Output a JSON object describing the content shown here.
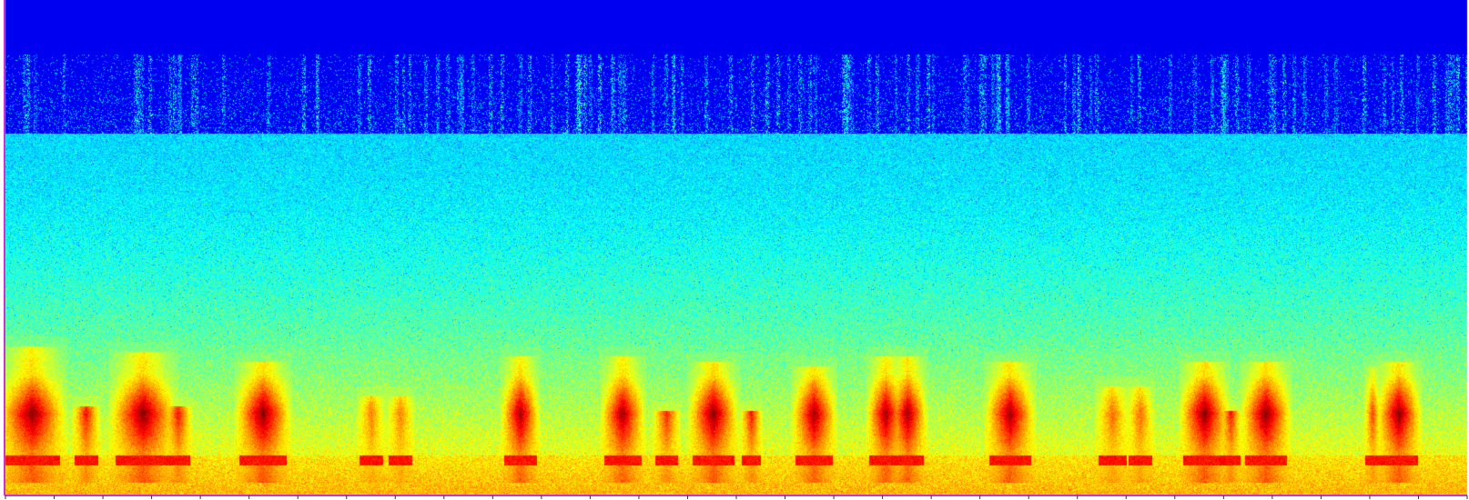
{
  "chart_data": {
    "type": "heatmap",
    "kind": "spectrogram",
    "colormap": "jet",
    "title": "",
    "xlabel": "",
    "ylabel": "",
    "axis_frame_color": "#cc33cc",
    "colors": {
      "silent_band": "#000a8c",
      "noise_band": "#38c8e8",
      "low_band": "#f0e830",
      "hot_syllable": "#b81808"
    },
    "band_edges_fraction_of_height": {
      "silent_band_end": 0.27,
      "noise_floor_to_low_band_transition": [
        0.58,
        0.78
      ]
    },
    "syllables": [
      {
        "t": 0.018,
        "width": 0.024,
        "top": 0.7,
        "intensity": 1.0
      },
      {
        "t": 0.055,
        "width": 0.01,
        "top": 0.82,
        "intensity": 0.7
      },
      {
        "t": 0.094,
        "width": 0.024,
        "top": 0.71,
        "intensity": 1.0
      },
      {
        "t": 0.118,
        "width": 0.01,
        "top": 0.82,
        "intensity": 0.7
      },
      {
        "t": 0.176,
        "width": 0.02,
        "top": 0.73,
        "intensity": 1.0
      },
      {
        "t": 0.25,
        "width": 0.01,
        "top": 0.8,
        "intensity": 0.45
      },
      {
        "t": 0.27,
        "width": 0.01,
        "top": 0.8,
        "intensity": 0.45
      },
      {
        "t": 0.352,
        "width": 0.014,
        "top": 0.72,
        "intensity": 0.95
      },
      {
        "t": 0.422,
        "width": 0.016,
        "top": 0.72,
        "intensity": 0.95
      },
      {
        "t": 0.452,
        "width": 0.01,
        "top": 0.83,
        "intensity": 0.65
      },
      {
        "t": 0.484,
        "width": 0.018,
        "top": 0.73,
        "intensity": 1.0
      },
      {
        "t": 0.51,
        "width": 0.008,
        "top": 0.83,
        "intensity": 0.7
      },
      {
        "t": 0.553,
        "width": 0.016,
        "top": 0.74,
        "intensity": 0.95
      },
      {
        "t": 0.602,
        "width": 0.014,
        "top": 0.72,
        "intensity": 0.95
      },
      {
        "t": 0.617,
        "width": 0.014,
        "top": 0.72,
        "intensity": 0.95
      },
      {
        "t": 0.687,
        "width": 0.018,
        "top": 0.73,
        "intensity": 0.95
      },
      {
        "t": 0.757,
        "width": 0.012,
        "top": 0.78,
        "intensity": 0.5
      },
      {
        "t": 0.776,
        "width": 0.01,
        "top": 0.78,
        "intensity": 0.5
      },
      {
        "t": 0.82,
        "width": 0.018,
        "top": 0.73,
        "intensity": 1.0
      },
      {
        "t": 0.838,
        "width": 0.008,
        "top": 0.83,
        "intensity": 0.7
      },
      {
        "t": 0.862,
        "width": 0.018,
        "top": 0.73,
        "intensity": 1.0
      },
      {
        "t": 0.935,
        "width": 0.006,
        "top": 0.74,
        "intensity": 0.6
      },
      {
        "t": 0.953,
        "width": 0.016,
        "top": 0.73,
        "intensity": 1.0
      }
    ],
    "x_ticks_count": 31
  }
}
